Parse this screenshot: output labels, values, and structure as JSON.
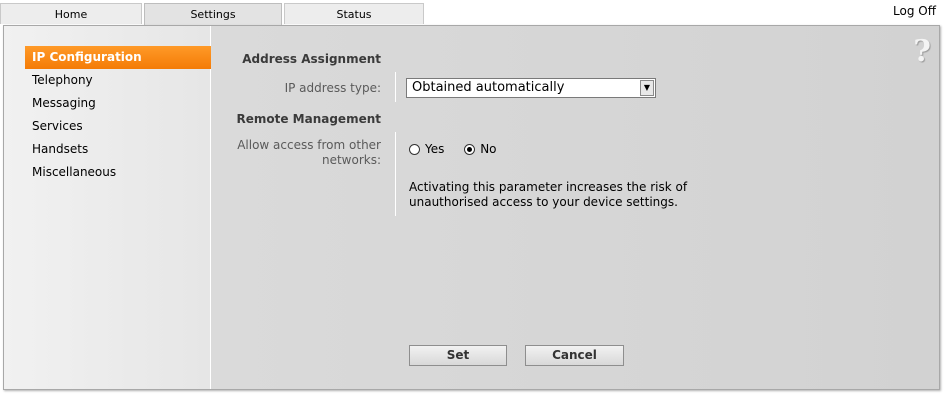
{
  "tabs": [
    {
      "label": "Home"
    },
    {
      "label": "Settings"
    },
    {
      "label": "Status"
    }
  ],
  "header": {
    "logoff_label": "Log Off",
    "help_glyph": "?"
  },
  "sidebar": {
    "items": [
      {
        "label": "IP Configuration"
      },
      {
        "label": "Telephony"
      },
      {
        "label": "Messaging"
      },
      {
        "label": "Services"
      },
      {
        "label": "Handsets"
      },
      {
        "label": "Miscellaneous"
      }
    ]
  },
  "form": {
    "address_section": "Address Assignment",
    "ip_type_label": "IP address type:",
    "ip_type_value": "Obtained automatically",
    "remote_section": "Remote Management",
    "access_label": "Allow access from other networks:",
    "radio_yes": "Yes",
    "radio_no": "No",
    "selected_option": "No",
    "info_text": "Activating this parameter increases the risk of unauthorised access to your device settings."
  },
  "buttons": {
    "set": "Set",
    "cancel": "Cancel"
  },
  "colors": {
    "accent": "#f47b06",
    "frame_bg": "#d6d6d6"
  }
}
